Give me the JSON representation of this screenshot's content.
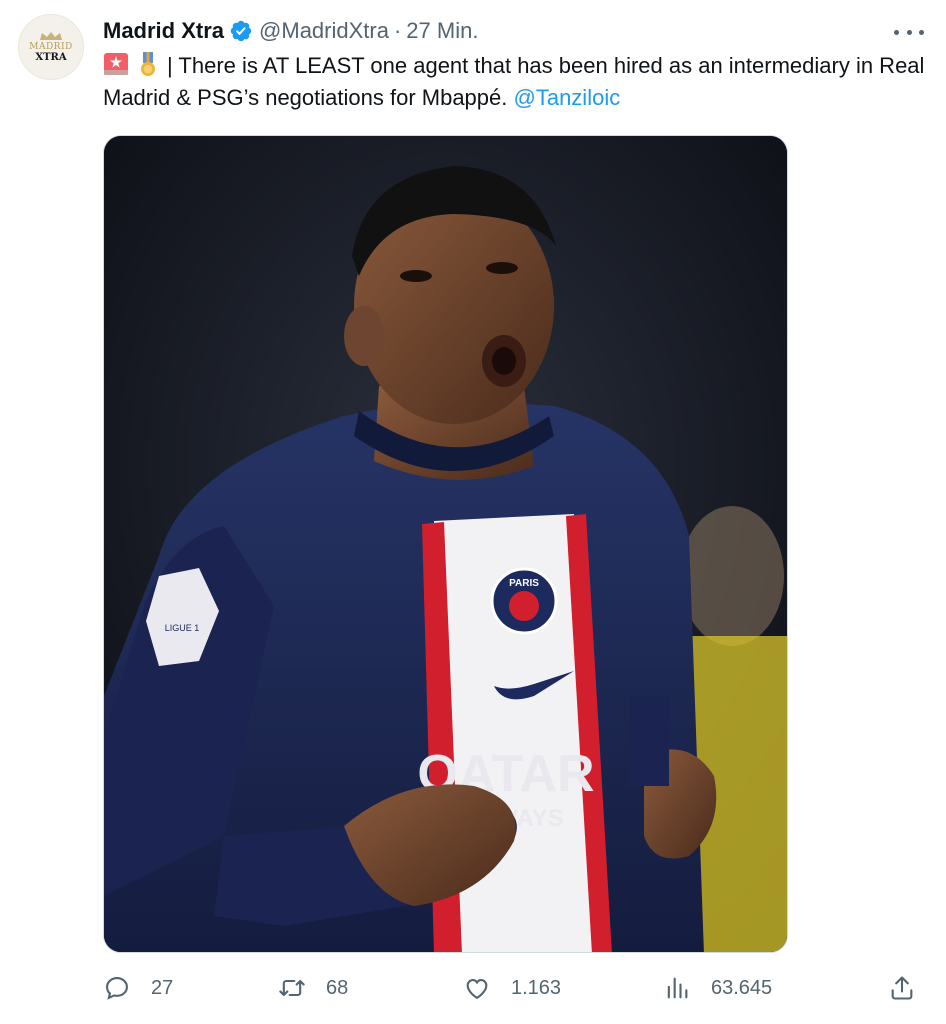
{
  "tweet": {
    "avatar": {
      "line1": "MADRID",
      "line2": "XTRA"
    },
    "display_name": "Madrid Xtra",
    "verified_icon": "verified-badge-icon",
    "handle": "@MadridXtra",
    "separator": "·",
    "time": "27 Min.",
    "emojis": [
      "rotating-light-icon",
      "medal-icon"
    ],
    "text_main": "| There is AT LEAST one agent that has been hired as an intermediary in Real Madrid & PSG’s negotiations for Mbappé.",
    "mention": "@Tanziloic",
    "media": {
      "jersey_sponsor_line1": "QATAR",
      "jersey_sponsor_line2": "AIRWAYS",
      "badge_text": "PARIS",
      "sleeve_text": "LIGUE 1"
    },
    "actions": {
      "reply_count": "27",
      "retweet_count": "68",
      "like_count": "1.163",
      "views_count": "63.645"
    },
    "colors": {
      "accent": "#1d9bf0",
      "muted": "#536471",
      "text": "#0f1419",
      "jersey": "#1f2a55",
      "stripe_red": "#d11f2e"
    }
  }
}
